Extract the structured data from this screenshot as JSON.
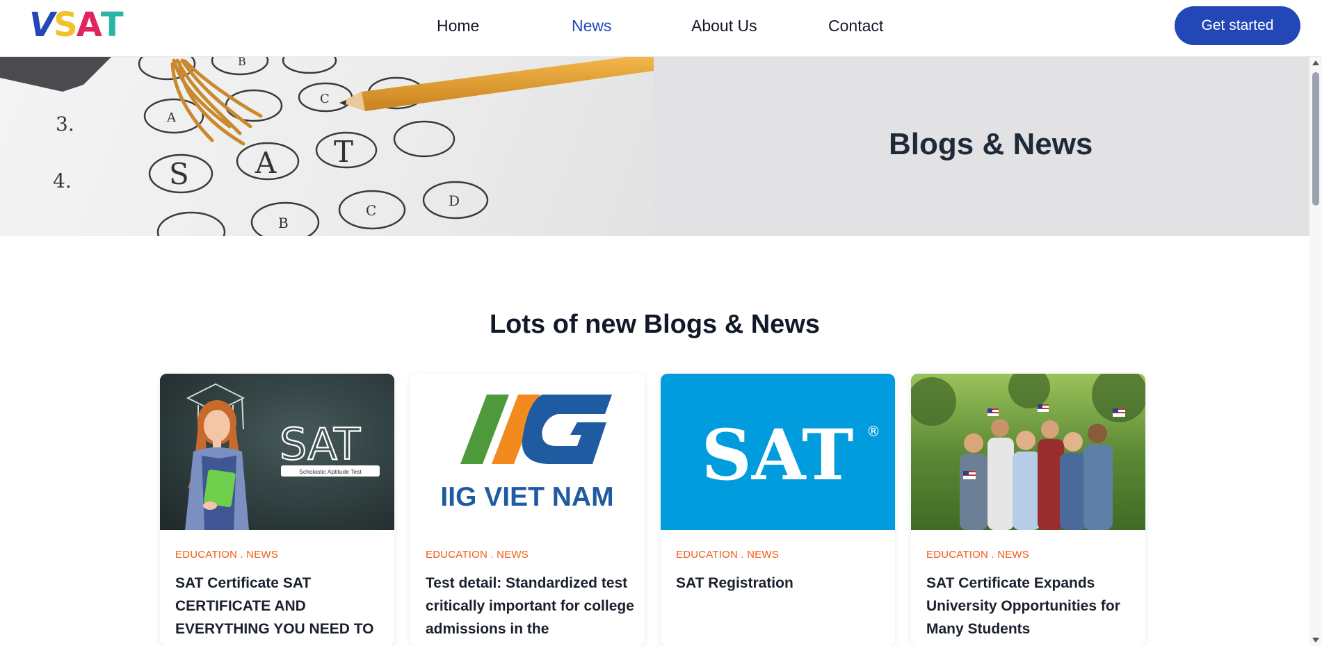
{
  "header": {
    "logo": {
      "v": "V",
      "s": "S",
      "a": "A",
      "t": "T"
    },
    "nav": [
      {
        "label": "Home",
        "active": false
      },
      {
        "label": "News",
        "active": true
      },
      {
        "label": "About Us",
        "active": false
      },
      {
        "label": "Contact",
        "active": false
      }
    ],
    "cta_label": "Get started"
  },
  "hero": {
    "title": "Blogs & News",
    "image": {
      "row_numbers": [
        "3.",
        "4."
      ],
      "bubble_letters": {
        "a": "A",
        "b": "B",
        "c": "C",
        "d": "D",
        "s": "S",
        "t": "T"
      }
    }
  },
  "section": {
    "title": "Lots of new Blogs & News"
  },
  "cards": [
    {
      "category": "EDUCATION . NEWS",
      "title": "SAT Certificate SAT CERTIFICATE AND EVERYTHING YOU NEED TO",
      "image": {
        "big_text": "SAT",
        "sub_text": "Scholastic Aptitude Test"
      }
    },
    {
      "category": "EDUCATION . NEWS",
      "title": "Test detail: Standardized test critically important for college admissions in the",
      "image": {
        "brand_text": "IIG VIET NAM"
      }
    },
    {
      "category": "EDUCATION . NEWS",
      "title": "SAT Registration",
      "image": {
        "big_text": "SAT",
        "mark": "®"
      }
    },
    {
      "category": "EDUCATION . NEWS",
      "title": "SAT Certificate Expands University Opportunities for Many Students",
      "image": {}
    }
  ],
  "colors": {
    "brand_blue": "#2447b8",
    "accent_orange": "#f05a14",
    "sat_blue": "#009cde",
    "logo_yellow": "#f2c12e",
    "logo_pink": "#e0245e",
    "logo_teal": "#2bb5a5"
  }
}
